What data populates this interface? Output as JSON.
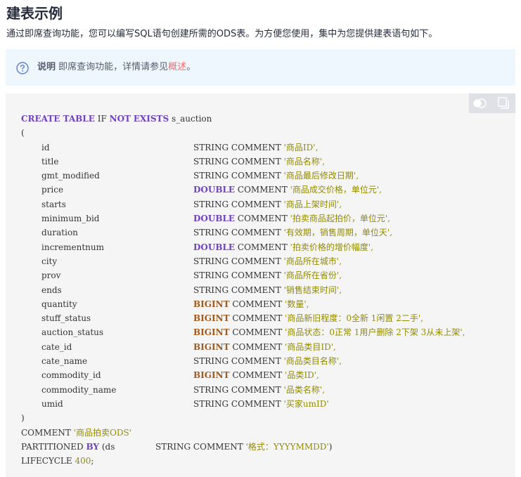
{
  "page": {
    "title": "建表示例",
    "intro": "通过即席查询功能，您可以编写SQL语句创建所需的ODS表。为方便您使用，集中为您提供建表语句如下。"
  },
  "note": {
    "icon": "question-circle-icon",
    "label": "说明",
    "text": "即席查询功能，详情请参见",
    "link": "概述",
    "suffix": "。",
    "bg_color": "#eef6fe",
    "link_color": "#f66f6a"
  },
  "toolbar": {
    "toggle_icon": "theme-toggle-icon",
    "copy_icon": "copy-icon"
  },
  "code": {
    "create_kw": "CREATE TABLE",
    "if_kw": "IF",
    "not_kw": "NOT",
    "exists_kw": "EXISTS",
    "table_name": "s_auction",
    "open_paren": "(",
    "columns": [
      {
        "name": "id",
        "type": "STRING",
        "comment_kw": "COMMENT",
        "comment": "'商品ID',"
      },
      {
        "name": "title",
        "type": "STRING",
        "comment_kw": "COMMENT",
        "comment": "'商品名称',"
      },
      {
        "name": "gmt_modified",
        "type": "STRING",
        "comment_kw": "COMMENT",
        "comment": "'商品最后修改日期',"
      },
      {
        "name": "price",
        "type": "DOUBLE",
        "comment_kw": "COMMENT",
        "comment": "'商品成交价格，单位元',"
      },
      {
        "name": "starts",
        "type": "STRING",
        "comment_kw": "COMMENT",
        "comment": "'商品上架时间',"
      },
      {
        "name": "minimum_bid",
        "type": "DOUBLE",
        "comment_kw": "COMMENT",
        "comment": "'拍卖商品起拍价，单位元',"
      },
      {
        "name": "duration",
        "type": "STRING",
        "comment_kw": "COMMENT",
        "comment": "'有效期，销售周期，单位天',"
      },
      {
        "name": "incrementnum",
        "type": "DOUBLE",
        "comment_kw": "COMMENT",
        "comment": "'拍卖价格的增价幅度',"
      },
      {
        "name": "city",
        "type": "STRING",
        "comment_kw": "COMMENT",
        "comment": "'商品所在城市',"
      },
      {
        "name": "prov",
        "type": "STRING",
        "comment_kw": "COMMENT",
        "comment": "'商品所在省份',"
      },
      {
        "name": "ends",
        "type": "STRING",
        "comment_kw": "COMMENT",
        "comment": "'销售结束时间',"
      },
      {
        "name": "quantity",
        "type": "BIGINT",
        "comment_kw": "COMMENT",
        "comment": "'数量',"
      },
      {
        "name": "stuff_status",
        "type": "BIGINT",
        "comment_kw": "COMMENT",
        "comment": "'商品新旧程度：0全新 1闲置 2二手',"
      },
      {
        "name": "auction_status",
        "type": "BIGINT",
        "comment_kw": "COMMENT",
        "comment": "'商品状态：0正常 1用户删除 2下架 3从未上架',"
      },
      {
        "name": "cate_id",
        "type": "BIGINT",
        "comment_kw": "COMMENT",
        "comment": "'商品类目ID',"
      },
      {
        "name": "cate_name",
        "type": "STRING",
        "comment_kw": "COMMENT",
        "comment": "'商品类目名称',"
      },
      {
        "name": "commodity_id",
        "type": "BIGINT",
        "comment_kw": "COMMENT",
        "comment": "'品类ID',"
      },
      {
        "name": "commodity_name",
        "type": "STRING",
        "comment_kw": "COMMENT",
        "comment": "'品类名称',"
      },
      {
        "name": "umid",
        "type": "STRING",
        "comment_kw": "COMMENT",
        "comment": "'买家umID'"
      }
    ],
    "close_paren": ")",
    "table_comment_kw": "COMMENT",
    "table_comment": "'商品拍卖ODS'",
    "partitioned_kw": "PARTITIONED",
    "by_kw": "BY",
    "partition_open": "(ds",
    "partition_type": "STRING",
    "partition_comment_kw": "COMMENT",
    "partition_comment": "'格式：YYYYMMDD'",
    "partition_close": ")",
    "lifecycle_kw": "LIFECYCLE",
    "lifecycle_value": "400",
    "semicolon": ";"
  },
  "colors": {
    "keyword_purple": "#6f42c1",
    "keyword_brown": "#a15a1d",
    "string_olive": "#928c00",
    "code_bg": "#f5f5f5"
  }
}
